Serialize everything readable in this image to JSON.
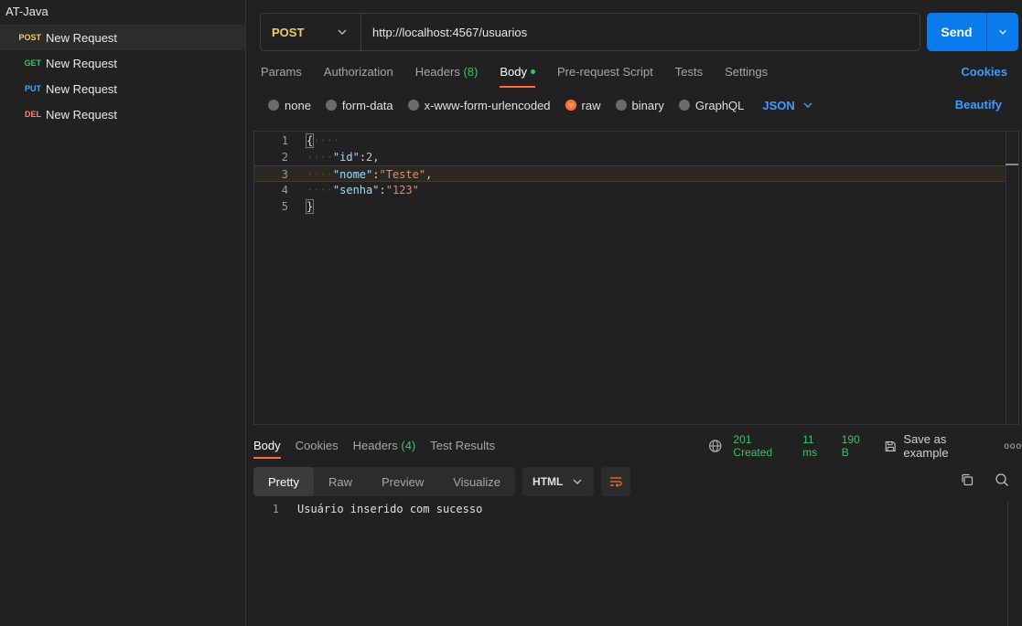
{
  "sidebar": {
    "collection_title": "AT-Java",
    "items": [
      {
        "method": "POST",
        "method_color": "#f5c96b",
        "label": "New Request",
        "active": true
      },
      {
        "method": "GET",
        "method_color": "#36c46c",
        "label": "New Request",
        "active": false
      },
      {
        "method": "PUT",
        "method_color": "#4aa7f2",
        "label": "New Request",
        "active": false
      },
      {
        "method": "DEL",
        "method_color": "#ef8a7a",
        "label": "New Request",
        "active": false
      }
    ]
  },
  "request": {
    "method": "POST",
    "url": "http://localhost:4567/usuarios",
    "send_label": "Send"
  },
  "req_tabs": {
    "params": "Params",
    "authorization": "Authorization",
    "headers": "Headers",
    "headers_count": "(8)",
    "body": "Body",
    "pre_request": "Pre-request Script",
    "tests": "Tests",
    "settings": "Settings",
    "cookies": "Cookies"
  },
  "body_types": {
    "none": "none",
    "form_data": "form-data",
    "urlencoded": "x-www-form-urlencoded",
    "raw": "raw",
    "binary": "binary",
    "graphql": "GraphQL",
    "format": "JSON",
    "beautify": "Beautify",
    "selected": "raw"
  },
  "editor": {
    "lines": [
      {
        "n": "1",
        "ws": "····",
        "key": "",
        "sep": "",
        "val": "",
        "open": "{"
      },
      {
        "n": "2",
        "ws": "····",
        "key": "\"id\"",
        "sep": ":",
        "val": "2",
        "tail": ","
      },
      {
        "n": "3",
        "ws": "····",
        "key": "\"nome\"",
        "sep": ":",
        "val": "\"Teste\"",
        "tail": ","
      },
      {
        "n": "4",
        "ws": "····",
        "key": "\"senha\"",
        "sep": ":",
        "val": "\"123\"",
        "tail": ""
      },
      {
        "n": "5",
        "ws": "",
        "key": "",
        "sep": "",
        "val": "",
        "close": "}"
      }
    ]
  },
  "response": {
    "tabs": {
      "body": "Body",
      "cookies": "Cookies",
      "headers": "Headers",
      "headers_count": "(4)",
      "test_results": "Test Results"
    },
    "status": "201 Created",
    "time": "11 ms",
    "size": "190 B",
    "save_example": "Save as example",
    "more": "ooo",
    "views": {
      "pretty": "Pretty",
      "raw": "Raw",
      "preview": "Preview",
      "visualize": "Visualize"
    },
    "format": "HTML",
    "line_number": "1",
    "body_text": "Usuário inserido com sucesso"
  }
}
